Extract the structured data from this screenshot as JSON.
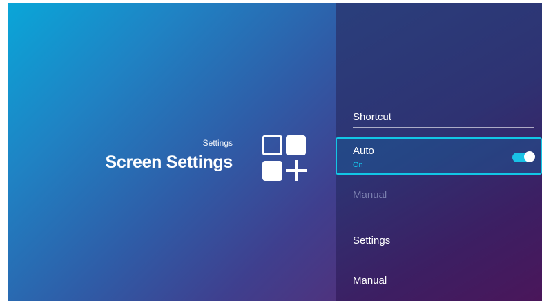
{
  "colors": {
    "accent": "#14c9ef",
    "disabled_text": "#7a7fae",
    "left_gradient_start": "#0aa6d8",
    "right_gradient_end": "#4a165a"
  },
  "header": {
    "subtitle": "Settings",
    "title": "Screen Settings",
    "icon": "apps-add-icon"
  },
  "menu": {
    "shortcut_section": {
      "label": "Shortcut",
      "items": [
        {
          "label": "Auto",
          "value": "On",
          "toggle_on": true,
          "selected": true
        },
        {
          "label": "Manual",
          "disabled": true
        }
      ]
    },
    "settings_section": {
      "label": "Settings",
      "items": [
        {
          "label": "Manual"
        }
      ]
    }
  }
}
